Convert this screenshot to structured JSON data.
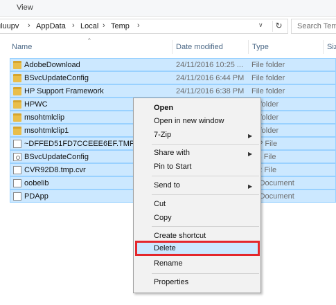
{
  "ribbon": {
    "view_tab": "View"
  },
  "address": {
    "crumbs": [
      "uluupv",
      "AppData",
      "Local",
      "Temp"
    ],
    "separator": "›",
    "dropdown_glyph": "∨",
    "refresh_glyph": "↻"
  },
  "search": {
    "placeholder": "Search Tem"
  },
  "columns": {
    "name": "Name",
    "date": "Date modified",
    "type": "Type",
    "size": "Siz"
  },
  "files": [
    {
      "name": "AdobeDownload",
      "date": "24/11/2016 10:25 ...",
      "type": "File folder",
      "icon": "folder-icon"
    },
    {
      "name": "BSvcUpdateConfig",
      "date": "24/11/2016 6:44 PM",
      "type": "File folder",
      "icon": "folder-icon"
    },
    {
      "name": "HP Support Framework",
      "date": "24/11/2016 6:38 PM",
      "type": "File folder",
      "icon": "folder-icon"
    },
    {
      "name": "HPWC",
      "date": "",
      "type": "le folder",
      "icon": "folder-icon"
    },
    {
      "name": "msohtmlclip",
      "date": "",
      "type": "le folder",
      "icon": "folder-icon"
    },
    {
      "name": "msohtmlclip1",
      "date": "",
      "type": "le folder",
      "icon": "folder-icon"
    },
    {
      "name": "~DFFED51FD7CCEEE6EF.TMP",
      "date": "",
      "type": "MP File",
      "icon": "file-icon"
    },
    {
      "name": "BSvcUpdateConfig",
      "date": "",
      "type": "AB File",
      "icon": "config-file-icon"
    },
    {
      "name": "CVR92D8.tmp.cvr",
      "date": "",
      "type": "VR File",
      "icon": "file-icon"
    },
    {
      "name": "oobelib",
      "date": "",
      "type": "xt Document",
      "icon": "file-icon"
    },
    {
      "name": "PDApp",
      "date": "",
      "type": "xt Document",
      "icon": "file-icon"
    }
  ],
  "context_menu": {
    "open": "Open",
    "open_new_window": "Open in new window",
    "zip": "7-Zip",
    "share_with": "Share with",
    "pin_to_start": "Pin to Start",
    "send_to": "Send to",
    "cut": "Cut",
    "copy": "Copy",
    "create_shortcut": "Create shortcut",
    "delete": "Delete",
    "rename": "Rename",
    "properties": "Properties",
    "submenu_arrow": "▶"
  },
  "colors": {
    "selection": "#cce8ff",
    "selection_border": "#99d1ff",
    "highlight_box": "#e4272c",
    "folder": "#e9be4a"
  }
}
